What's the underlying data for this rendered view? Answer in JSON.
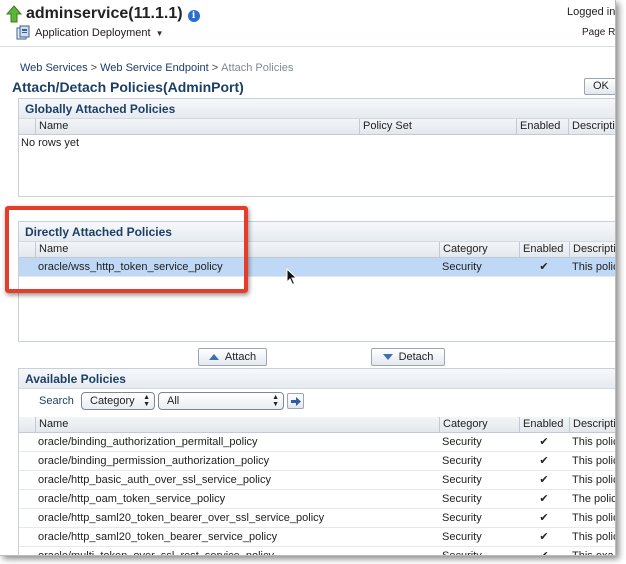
{
  "header": {
    "app_title": "adminservice(11.1.1)",
    "logged_in": "Logged in",
    "page_ref": "Page R",
    "deploy_menu_label": "Application Deployment"
  },
  "breadcrumb": {
    "items": [
      "Web Services",
      "Web Service Endpoint",
      "Attach Policies"
    ],
    "separator": ">"
  },
  "page": {
    "title": "Attach/Detach Policies(AdminPort)",
    "ok_label": "OK"
  },
  "global_panel": {
    "title": "Globally Attached Policies",
    "columns": [
      "Name",
      "Policy Set",
      "Enabled",
      "Description"
    ],
    "empty_text": "No rows yet"
  },
  "direct_panel": {
    "title": "Directly Attached Policies",
    "columns": [
      "Name",
      "Category",
      "Enabled",
      "Description"
    ],
    "rows": [
      {
        "name": "oracle/wss_http_token_service_policy",
        "category": "Security",
        "enabled": "✔",
        "description": "This policy"
      }
    ]
  },
  "actions": {
    "attach_label": "Attach",
    "detach_label": "Detach"
  },
  "available_panel": {
    "title": "Available Policies",
    "search_label": "Search",
    "search_field_value": "Category",
    "search_value": "All",
    "columns": [
      "Name",
      "Category",
      "Enabled",
      "Description"
    ],
    "rows": [
      {
        "name": "oracle/binding_authorization_permitall_policy",
        "category": "Security",
        "enabled": "✔",
        "description": "This policy"
      },
      {
        "name": "oracle/binding_permission_authorization_policy",
        "category": "Security",
        "enabled": "✔",
        "description": "This policy"
      },
      {
        "name": "oracle/http_basic_auth_over_ssl_service_policy",
        "category": "Security",
        "enabled": "✔",
        "description": "This policy"
      },
      {
        "name": "oracle/http_oam_token_service_policy",
        "category": "Security",
        "enabled": "✔",
        "description": "The policy"
      },
      {
        "name": "oracle/http_saml20_token_bearer_over_ssl_service_policy",
        "category": "Security",
        "enabled": "✔",
        "description": "This policy"
      },
      {
        "name": "oracle/http_saml20_token_bearer_service_policy",
        "category": "Security",
        "enabled": "✔",
        "description": "This policy"
      },
      {
        "name": "oracle/multi_token_over_ssl_rest_service_policy",
        "category": "Security",
        "enabled": "✔",
        "description": "This exa"
      }
    ]
  },
  "colors": {
    "title_blue": "#1c3f66",
    "selected_row": "#bfd8f5",
    "highlight_red": "#e63d2a"
  },
  "icons": {
    "up": "up-arrow-icon",
    "info": "info-icon",
    "deploy": "deployment-icon",
    "check": "check-icon",
    "go": "go-arrow-icon",
    "cursor": "mouse-pointer-icon"
  }
}
